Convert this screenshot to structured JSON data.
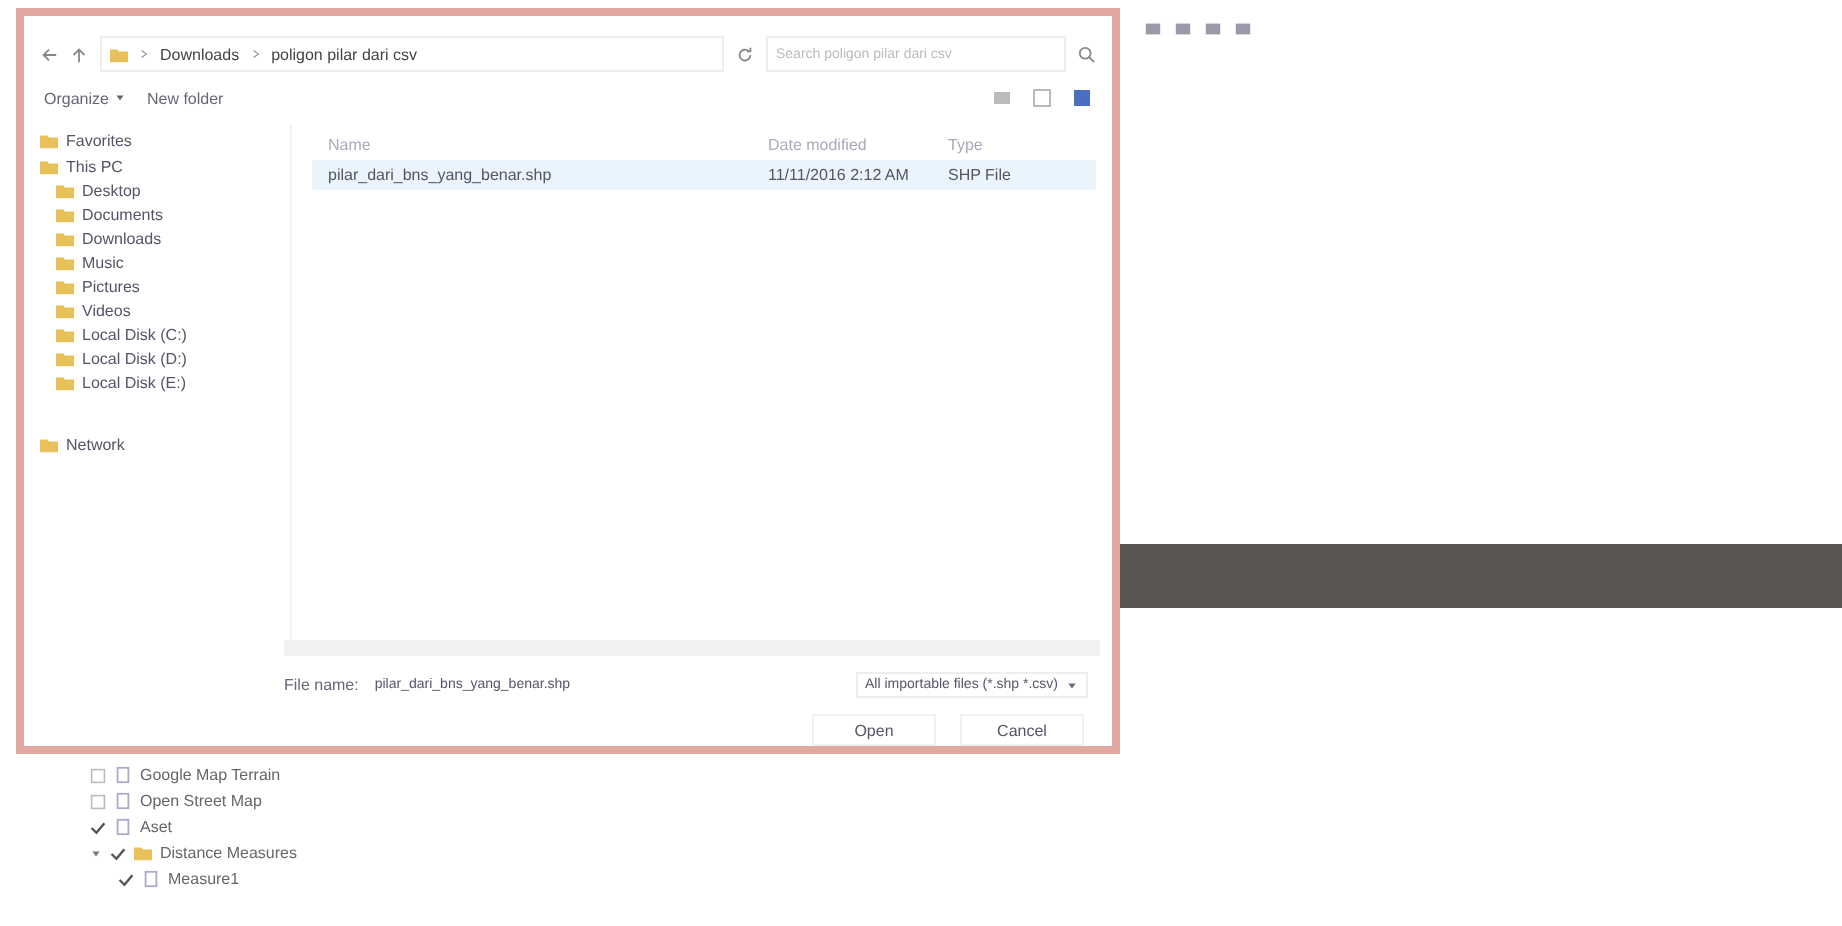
{
  "app": {
    "layers": [
      {
        "name": "Google Map Terrain",
        "checked": false
      },
      {
        "name": "Open Street Map",
        "checked": false
      },
      {
        "name": "Aset",
        "checked": true
      },
      {
        "name": "Distance Measures",
        "checked": true,
        "expanded": true,
        "children": [
          {
            "name": "Measure1",
            "checked": true
          }
        ]
      }
    ]
  },
  "dialog": {
    "breadcrumb": [
      "Downloads",
      "poligon pilar dari csv"
    ],
    "search": {
      "placeholder": "Search poligon pilar dari csv"
    },
    "toolbar": [
      "Organize",
      "New folder"
    ],
    "sidebar": {
      "items": [
        {
          "label": "Favorites"
        },
        {
          "label": "This PC",
          "children": [
            {
              "label": "Desktop"
            },
            {
              "label": "Documents"
            },
            {
              "label": "Downloads"
            },
            {
              "label": "Music"
            },
            {
              "label": "Pictures"
            },
            {
              "label": "Videos"
            },
            {
              "label": "Local Disk (C:)"
            },
            {
              "label": "Local Disk (D:)"
            },
            {
              "label": "Local Disk (E:)"
            }
          ]
        },
        {
          "label": "Network"
        }
      ]
    },
    "table": {
      "columns": [
        "Name",
        "Date modified",
        "Type"
      ],
      "rows": [
        {
          "cells": [
            "pilar_dari_bns_yang_benar.shp",
            "11/11/2016 2:12 AM",
            "SHP File"
          ],
          "selected": true
        }
      ]
    },
    "file_name": {
      "label": "File name:",
      "value": "pilar_dari_bns_yang_benar.shp"
    },
    "file_type": "All importable files (*.shp *.csv)",
    "buttons": [
      "Open",
      "Cancel"
    ]
  }
}
